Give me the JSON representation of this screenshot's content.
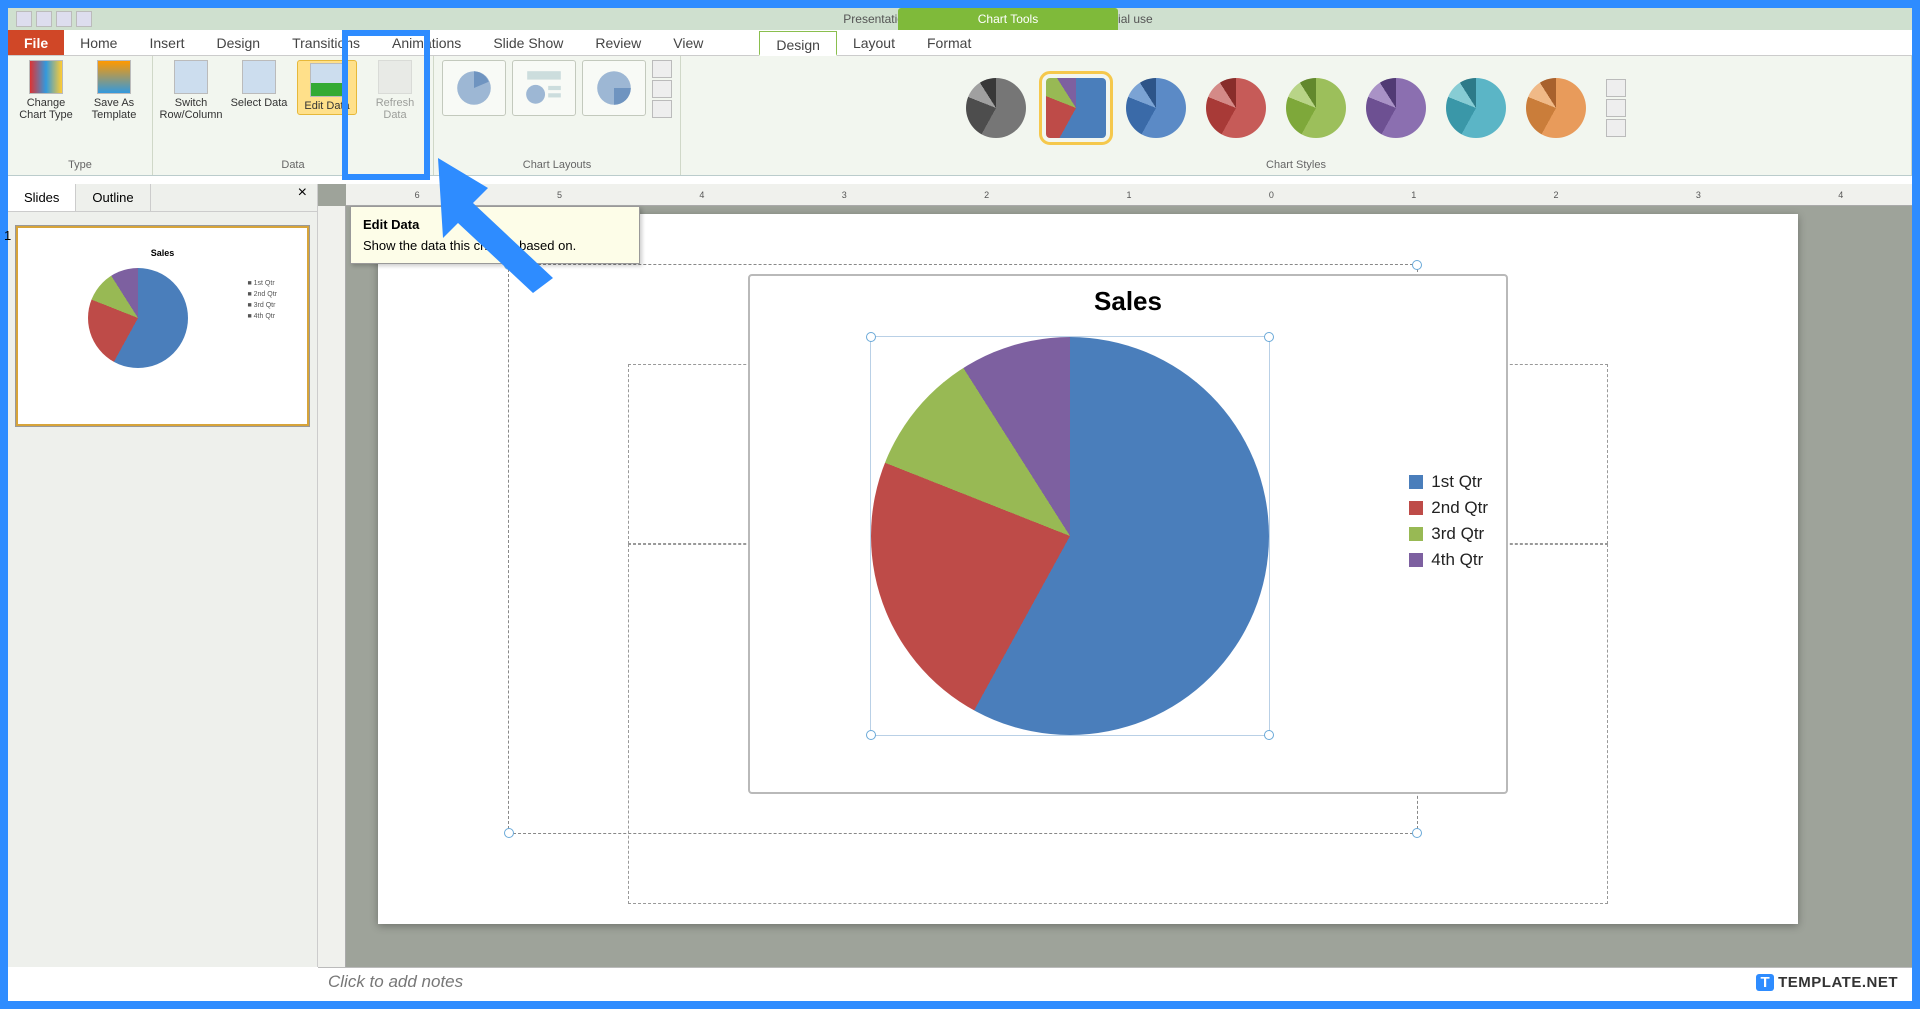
{
  "window": {
    "title": "Presentation2 - Microsoft PowerPoint non-commercial use"
  },
  "contextual_tab": "Chart Tools",
  "tabs": {
    "file": "File",
    "home": "Home",
    "insert": "Insert",
    "design": "Design",
    "transitions": "Transitions",
    "animations": "Animations",
    "slideshow": "Slide Show",
    "review": "Review",
    "view": "View",
    "ct_design": "Design",
    "ct_layout": "Layout",
    "ct_format": "Format"
  },
  "ribbon": {
    "type_group": "Type",
    "change_chart": "Change Chart Type",
    "save_template": "Save As Template",
    "data_group": "Data",
    "switch": "Switch Row/Column",
    "select": "Select Data",
    "edit": "Edit Data",
    "refresh": "Refresh Data",
    "layouts_group": "Chart Layouts",
    "styles_group": "Chart Styles"
  },
  "tooltip": {
    "title": "Edit Data",
    "body": "Show the data this chart is based on."
  },
  "sidepanel": {
    "slides": "Slides",
    "outline": "Outline",
    "num": "1"
  },
  "ruler_marks": [
    "6",
    "5",
    "4",
    "3",
    "2",
    "1",
    "0",
    "1",
    "2",
    "3",
    "4"
  ],
  "notes_placeholder": "Click to add notes",
  "watermark": "TEMPLATE.NET",
  "chart_data": {
    "type": "pie",
    "title": "Sales",
    "categories": [
      "1st Qtr",
      "2nd Qtr",
      "3rd Qtr",
      "4th Qtr"
    ],
    "values": [
      58,
      23,
      10,
      9
    ],
    "colors": [
      "#4a7ebb",
      "#be4b48",
      "#98b954",
      "#7d60a0"
    ],
    "legend_position": "right"
  },
  "style_palettes": [
    [
      "#767676",
      "#4d4d4d",
      "#a0a0a0",
      "#383838"
    ],
    [
      "#4a7ebb",
      "#be4b48",
      "#98b954",
      "#7d60a0"
    ],
    [
      "#5b8ac6",
      "#3a6aa8",
      "#7ba3d4",
      "#2d5488"
    ],
    [
      "#c65b58",
      "#a83a37",
      "#d48a87",
      "#882d2a"
    ],
    [
      "#9cbf5b",
      "#7ea83a",
      "#b8d487",
      "#62882d"
    ],
    [
      "#8b6fb0",
      "#6d5092",
      "#a992c6",
      "#513a74"
    ],
    [
      "#5bb5c6",
      "#3a97a8",
      "#87ccd4",
      "#2d7a88"
    ],
    [
      "#e89b5b",
      "#ca7d3a",
      "#f0b987",
      "#a8612d"
    ]
  ]
}
